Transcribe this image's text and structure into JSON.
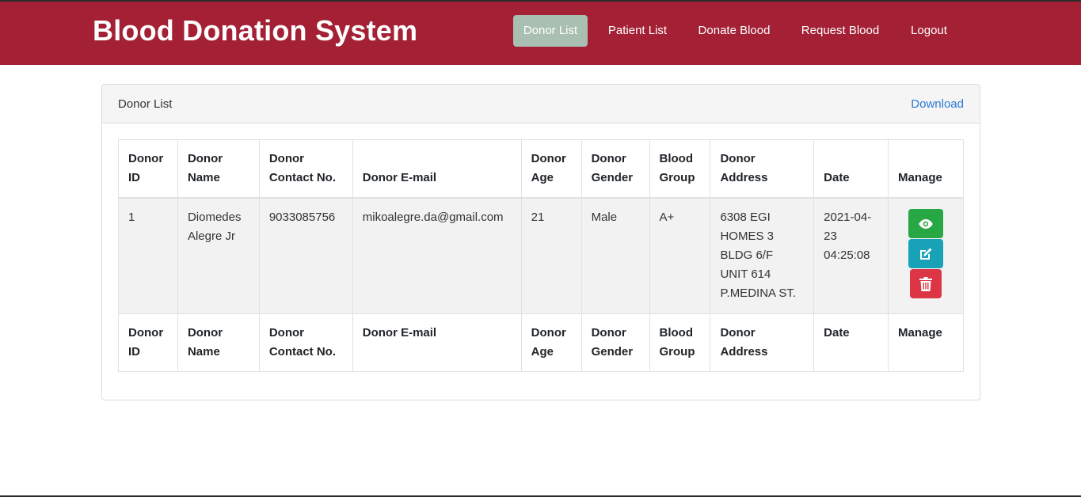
{
  "app": {
    "title": "Blood Donation System"
  },
  "nav": {
    "items": [
      {
        "label": "Donor List",
        "active": true
      },
      {
        "label": "Patient List",
        "active": false
      },
      {
        "label": "Donate Blood",
        "active": false
      },
      {
        "label": "Request Blood",
        "active": false
      },
      {
        "label": "Logout",
        "active": false
      }
    ]
  },
  "card": {
    "title": "Donor List",
    "download_label": "Download"
  },
  "table": {
    "headers": [
      "Donor ID",
      "Donor Name",
      "Donor Contact No.",
      "Donor E-mail",
      "Donor Age",
      "Donor Gender",
      "Blood Group",
      "Donor Address",
      "Date",
      "Manage"
    ],
    "rows": [
      {
        "id": "1",
        "name": "Diomedes Alegre Jr",
        "contact": "9033085756",
        "email": "mikoalegre.da@gmail.com",
        "age": "21",
        "gender": "Male",
        "blood_group": "A+",
        "address": "6308 EGI HOMES 3 BLDG 6/F UNIT 614 P.MEDINA ST.",
        "date": "2021-04-23 04:25:08"
      }
    ]
  },
  "icons": {
    "view": "eye-icon",
    "edit": "edit-icon",
    "delete": "trash-icon"
  },
  "colors": {
    "navbar": "#a32035",
    "active_nav": "#a9bfb2",
    "view_button": "#28a745",
    "edit_button": "#17a2b8",
    "delete_button": "#dc3545",
    "link": "#2a78d6"
  }
}
